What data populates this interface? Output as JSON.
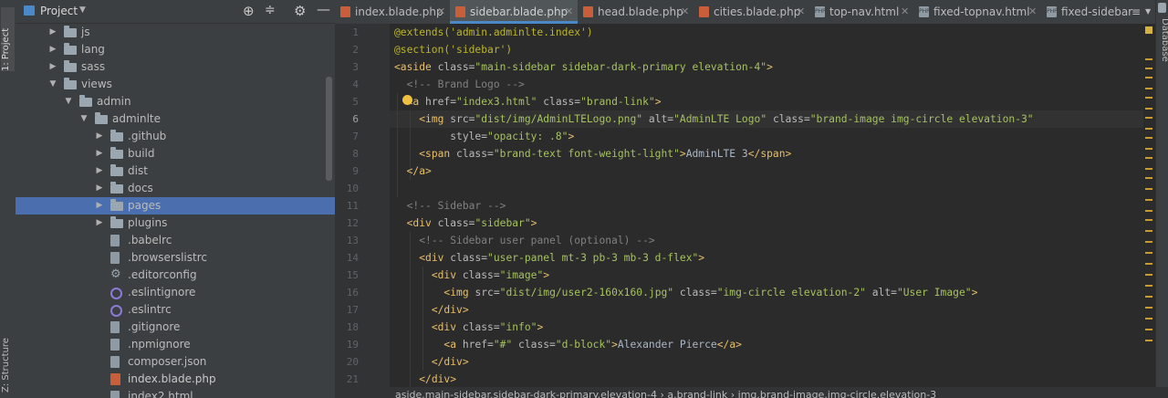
{
  "tool_strip": {
    "project_label": "1: Project",
    "structure_label": "Z: Structure",
    "database_label": "Database"
  },
  "project_panel": {
    "title": "Project",
    "tree": [
      {
        "label": "js",
        "type": "folder",
        "depth": 2,
        "expanded": false
      },
      {
        "label": "lang",
        "type": "folder",
        "depth": 2,
        "expanded": false
      },
      {
        "label": "sass",
        "type": "folder",
        "depth": 2,
        "expanded": false
      },
      {
        "label": "views",
        "type": "folder",
        "depth": 2,
        "expanded": true
      },
      {
        "label": "admin",
        "type": "folder",
        "depth": 3,
        "expanded": true
      },
      {
        "label": "adminlte",
        "type": "folder",
        "depth": 4,
        "expanded": true
      },
      {
        "label": ".github",
        "type": "folder",
        "depth": 5,
        "expanded": false
      },
      {
        "label": "build",
        "type": "folder",
        "depth": 5,
        "expanded": false
      },
      {
        "label": "dist",
        "type": "folder",
        "depth": 5,
        "expanded": false
      },
      {
        "label": "docs",
        "type": "folder",
        "depth": 5,
        "expanded": false
      },
      {
        "label": "pages",
        "type": "folder",
        "depth": 5,
        "expanded": false,
        "selected": true
      },
      {
        "label": "plugins",
        "type": "folder",
        "depth": 5,
        "expanded": false
      },
      {
        "label": ".babelrc",
        "type": "file",
        "depth": 5
      },
      {
        "label": ".browserslistrc",
        "type": "file",
        "depth": 5
      },
      {
        "label": ".editorconfig",
        "type": "gear",
        "depth": 5
      },
      {
        "label": ".eslintignore",
        "type": "ring",
        "depth": 5
      },
      {
        "label": ".eslintrc",
        "type": "ring",
        "depth": 5
      },
      {
        "label": ".gitignore",
        "type": "file",
        "depth": 5
      },
      {
        "label": ".npmignore",
        "type": "file",
        "depth": 5
      },
      {
        "label": "composer.json",
        "type": "file",
        "depth": 5
      },
      {
        "label": "index.blade.php",
        "type": "php",
        "depth": 5
      },
      {
        "label": "index2.html",
        "type": "file",
        "depth": 5
      }
    ]
  },
  "tabs": [
    {
      "label": "index.blade.php",
      "icon": "php-file-icon",
      "active": false,
      "closable": true
    },
    {
      "label": "sidebar.blade.php",
      "icon": "php-file-icon",
      "active": true,
      "closable": true
    },
    {
      "label": "head.blade.php",
      "icon": "php-file-icon",
      "active": false,
      "closable": true
    },
    {
      "label": "cities.blade.php",
      "icon": "php-file-icon",
      "active": false,
      "closable": true
    },
    {
      "label": "top-nav.html",
      "icon": "html-file-icon",
      "active": false,
      "closable": true
    },
    {
      "label": "fixed-topnav.html",
      "icon": "html-file-icon",
      "active": false,
      "closable": true
    },
    {
      "label": "fixed-sidebar",
      "icon": "html-file-icon",
      "active": false,
      "closable": false
    }
  ],
  "tab_overflow": "≡",
  "editor": {
    "current_line": 6,
    "lines": [
      {
        "n": "1",
        "tokens": [
          [
            "dir",
            "@extends('admin."
          ],
          [
            "dir",
            "adminlte"
          ],
          [
            "dir",
            ".index')"
          ]
        ]
      },
      {
        "n": "2",
        "tokens": [
          [
            "dir",
            "@section('sidebar')"
          ]
        ]
      },
      {
        "n": "3",
        "tokens": [
          [
            "tag",
            "<aside "
          ],
          [
            "attr",
            "class="
          ],
          [
            "str",
            "\"main-sidebar sidebar-dark-primary elevation-4\""
          ],
          [
            "tag",
            ">"
          ]
        ]
      },
      {
        "n": "4",
        "tokens": [
          [
            "txt",
            "  "
          ],
          [
            "com",
            "<!-- Brand Logo -->"
          ]
        ]
      },
      {
        "n": "5",
        "tokens": [
          [
            "txt",
            "  "
          ],
          [
            "tag",
            "<a "
          ],
          [
            "attr",
            "href="
          ],
          [
            "str",
            "\"index3.html\""
          ],
          [
            "attr",
            " class="
          ],
          [
            "str",
            "\"brand-link\""
          ],
          [
            "tag",
            ">"
          ]
        ]
      },
      {
        "n": "6",
        "tokens": [
          [
            "txt",
            "    "
          ],
          [
            "tag",
            "<img "
          ],
          [
            "attr",
            "src="
          ],
          [
            "str",
            "\"dist/img/AdminLTELogo.png\""
          ],
          [
            "attr",
            " alt="
          ],
          [
            "str",
            "\"AdminLTE Logo\""
          ],
          [
            "attr",
            " class="
          ],
          [
            "str",
            "\"brand-image img-circle elevation-3\""
          ]
        ]
      },
      {
        "n": "7",
        "tokens": [
          [
            "txt",
            "         "
          ],
          [
            "attr",
            "style="
          ],
          [
            "str",
            "\"opacity: .8\""
          ],
          [
            "tag",
            ">"
          ]
        ]
      },
      {
        "n": "8",
        "tokens": [
          [
            "txt",
            "    "
          ],
          [
            "tag",
            "<span "
          ],
          [
            "attr",
            "class="
          ],
          [
            "str",
            "\"brand-text font-weight-light\""
          ],
          [
            "tag",
            ">"
          ],
          [
            "txt",
            "AdminLTE 3"
          ],
          [
            "tag",
            "</span>"
          ]
        ]
      },
      {
        "n": "9",
        "tokens": [
          [
            "txt",
            "  "
          ],
          [
            "tag",
            "</a>"
          ]
        ]
      },
      {
        "n": "10",
        "tokens": []
      },
      {
        "n": "11",
        "tokens": [
          [
            "txt",
            "  "
          ],
          [
            "com",
            "<!-- Sidebar -->"
          ]
        ]
      },
      {
        "n": "12",
        "tokens": [
          [
            "txt",
            "  "
          ],
          [
            "tag",
            "<div "
          ],
          [
            "attr",
            "class="
          ],
          [
            "str",
            "\"sidebar\""
          ],
          [
            "tag",
            ">"
          ]
        ]
      },
      {
        "n": "13",
        "tokens": [
          [
            "txt",
            "    "
          ],
          [
            "com",
            "<!-- Sidebar user panel (optional) -->"
          ]
        ]
      },
      {
        "n": "14",
        "tokens": [
          [
            "txt",
            "    "
          ],
          [
            "tag",
            "<div "
          ],
          [
            "attr",
            "class="
          ],
          [
            "str",
            "\"user-panel mt-3 pb-3 mb-3 d-flex\""
          ],
          [
            "tag",
            ">"
          ]
        ]
      },
      {
        "n": "15",
        "tokens": [
          [
            "txt",
            "      "
          ],
          [
            "tag",
            "<div "
          ],
          [
            "attr",
            "class="
          ],
          [
            "str",
            "\"image\""
          ],
          [
            "tag",
            ">"
          ]
        ]
      },
      {
        "n": "16",
        "tokens": [
          [
            "txt",
            "        "
          ],
          [
            "tag",
            "<img "
          ],
          [
            "attr",
            "src="
          ],
          [
            "str",
            "\"dist/img/user2-160x160.jpg\""
          ],
          [
            "attr",
            " class="
          ],
          [
            "str",
            "\"img-circle elevation-2\""
          ],
          [
            "attr",
            " alt="
          ],
          [
            "str",
            "\"User Image\""
          ],
          [
            "tag",
            ">"
          ]
        ]
      },
      {
        "n": "17",
        "tokens": [
          [
            "txt",
            "      "
          ],
          [
            "tag",
            "</div>"
          ]
        ]
      },
      {
        "n": "18",
        "tokens": [
          [
            "txt",
            "      "
          ],
          [
            "tag",
            "<div "
          ],
          [
            "attr",
            "class="
          ],
          [
            "str",
            "\"info\""
          ],
          [
            "tag",
            ">"
          ]
        ]
      },
      {
        "n": "19",
        "tokens": [
          [
            "txt",
            "        "
          ],
          [
            "tag",
            "<a "
          ],
          [
            "attr",
            "href="
          ],
          [
            "str",
            "\"#\""
          ],
          [
            "attr",
            " class="
          ],
          [
            "str",
            "\"d-block\""
          ],
          [
            "tag",
            ">"
          ],
          [
            "txt",
            "Alexander Pierce"
          ],
          [
            "tag",
            "</a>"
          ]
        ]
      },
      {
        "n": "20",
        "tokens": [
          [
            "txt",
            "      "
          ],
          [
            "tag",
            "</div>"
          ]
        ]
      },
      {
        "n": "21",
        "tokens": [
          [
            "txt",
            "    "
          ],
          [
            "tag",
            "</div>"
          ]
        ]
      }
    ]
  },
  "breadcrumb": "aside.main-sidebar.sidebar-dark-primary.elevation-4   ›   a.brand-link   ›   img.brand-image.img-circle.elevation-3",
  "colors": {
    "selection": "#4b6eaf",
    "tab_accent": "#4a88c7",
    "tag": "#e8bf6a",
    "string": "#a5c261",
    "comment": "#808080",
    "directive": "#bbb529"
  }
}
